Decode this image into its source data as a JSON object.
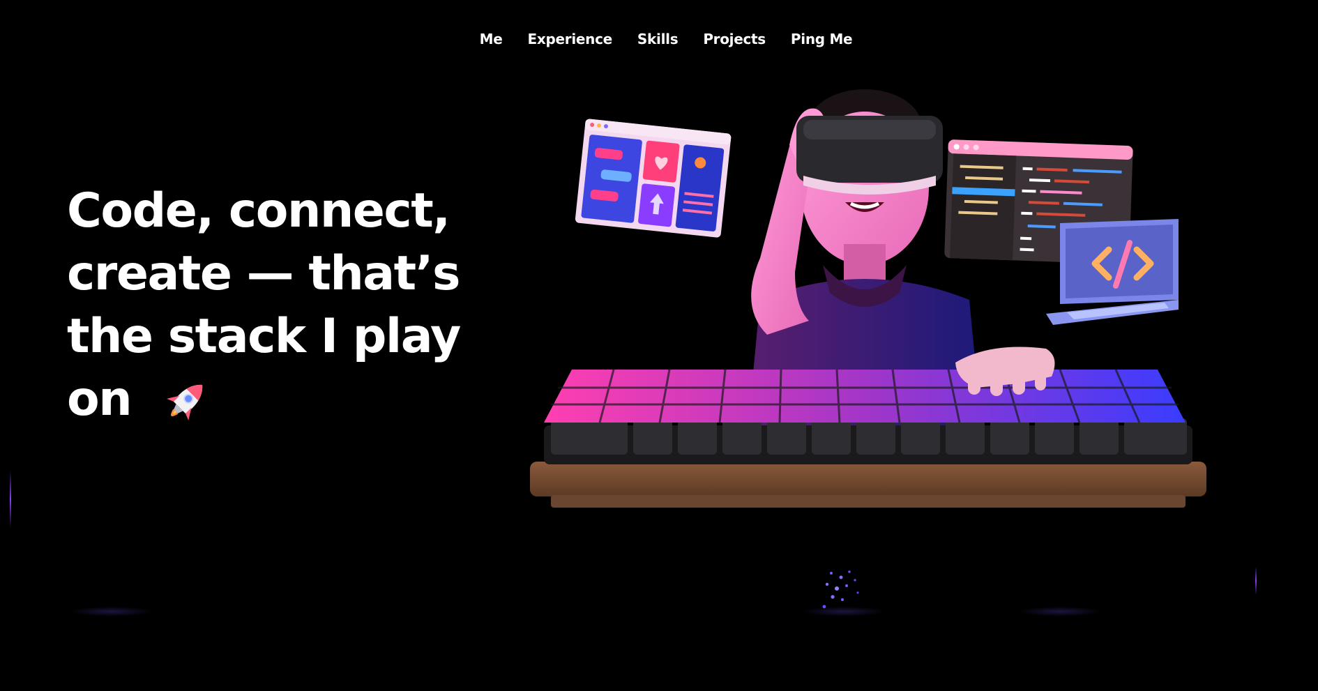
{
  "nav": {
    "items": [
      {
        "label": "Me"
      },
      {
        "label": "Experience"
      },
      {
        "label": "Skills"
      },
      {
        "label": "Projects"
      },
      {
        "label": "Ping Me"
      }
    ]
  },
  "hero": {
    "line1": "Code, connect,",
    "line2": "create — that’s",
    "line3": "the stack I play",
    "line4": "on"
  },
  "icons": {
    "rocket": "rocket-emoji-icon",
    "code": "code-brackets-icon",
    "heart": "heart-icon",
    "upload": "upload-arrow-icon"
  },
  "colors": {
    "background": "#000000",
    "text": "#ffffff",
    "accent_pink": "#ff4fc3",
    "accent_purple": "#6b3cff",
    "accent_blue": "#3a4bff"
  }
}
